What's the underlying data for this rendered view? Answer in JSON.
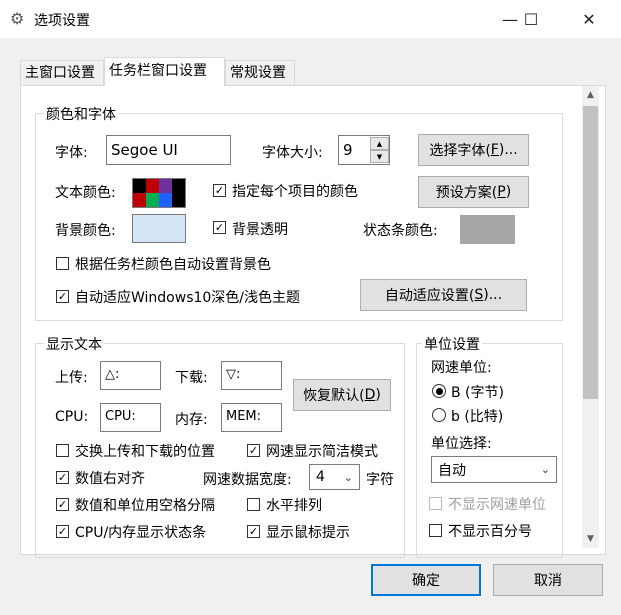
{
  "window": {
    "title": "选项设置",
    "icon": "gear-icon",
    "minimize_glyph": "—",
    "maximize_glyph": "☐",
    "close_glyph": "✕"
  },
  "tabs": [
    {
      "label": "主窗口设置",
      "active": false
    },
    {
      "label": "任务栏窗口设置",
      "active": true
    },
    {
      "label": "常规设置",
      "active": false
    }
  ],
  "color_font_group": {
    "title": "颜色和字体",
    "font_label": "字体:",
    "font_value": "Segoe UI",
    "font_size_label": "字体大小:",
    "font_size_value": "9",
    "select_font_button": "选择字体(",
    "select_font_key": "F",
    "select_font_suffix": ")...",
    "text_color_label": "文本颜色:",
    "text_colors": [
      "#c00000",
      "#00b050",
      "#2060ff",
      "#000000"
    ],
    "text_colors_top": [
      "#000000",
      "#c00000",
      "#7030a0",
      "#000000"
    ],
    "per_item_color_label": "指定每个项目的颜色",
    "per_item_color_checked": true,
    "preset_button": "预设方案(",
    "preset_key": "P",
    "preset_suffix": ")",
    "bg_color_label": "背景颜色:",
    "bg_color": "#d4e5f5",
    "bg_transparent_label": "背景透明",
    "bg_transparent_checked": true,
    "statusbar_color_label": "状态条颜色:",
    "statusbar_color": "#a6a6a6",
    "auto_bg_label": "根据任务栏颜色自动设置背景色",
    "auto_bg_checked": false,
    "auto_adapt_label": "自动适应Windows10深色/浅色主题",
    "auto_adapt_checked": true,
    "auto_adapt_button": "自动适应设置(",
    "auto_adapt_key": "S",
    "auto_adapt_suffix": ")..."
  },
  "display_text_group": {
    "title": "显示文本",
    "upload_label": "上传:",
    "upload_value": "△:",
    "download_label": "下载:",
    "download_value": "▽:",
    "restore_button": "恢复默认(",
    "restore_key": "D",
    "restore_suffix": ")",
    "cpu_label": "CPU:",
    "cpu_value": "CPU:",
    "mem_label": "内存:",
    "mem_value": "MEM:",
    "swap_label": "交换上传和下载的位置",
    "swap_checked": false,
    "simple_mode_label": "网速显示简洁模式",
    "simple_mode_checked": true,
    "right_align_label": "数值右对齐",
    "right_align_checked": true,
    "width_label": "网速数据宽度:",
    "width_value": "4",
    "width_unit": "字符",
    "space_sep_label": "数值和单位用空格分隔",
    "space_sep_checked": true,
    "horizontal_label": "水平排列",
    "horizontal_checked": false,
    "cpu_mem_bar_label": "CPU/内存显示状态条",
    "cpu_mem_bar_checked": true,
    "mouse_tip_label": "显示鼠标提示",
    "mouse_tip_checked": true
  },
  "unit_group": {
    "title": "单位设置",
    "speed_unit_label": "网速单位:",
    "radio_byte": "B (字节)",
    "radio_byte_selected": true,
    "radio_bit": "b (比特)",
    "radio_bit_selected": false,
    "unit_select_label": "单位选择:",
    "unit_select_value": "自动",
    "hide_unit_label": "不显示网速单位",
    "hide_unit_checked": false,
    "hide_unit_disabled": true,
    "hide_percent_label": "不显示百分号",
    "hide_percent_checked": false
  },
  "footer": {
    "ok_button": "确定",
    "cancel_button": "取消"
  },
  "check_glyph": "✓",
  "dropdown_glyph": "⌄"
}
